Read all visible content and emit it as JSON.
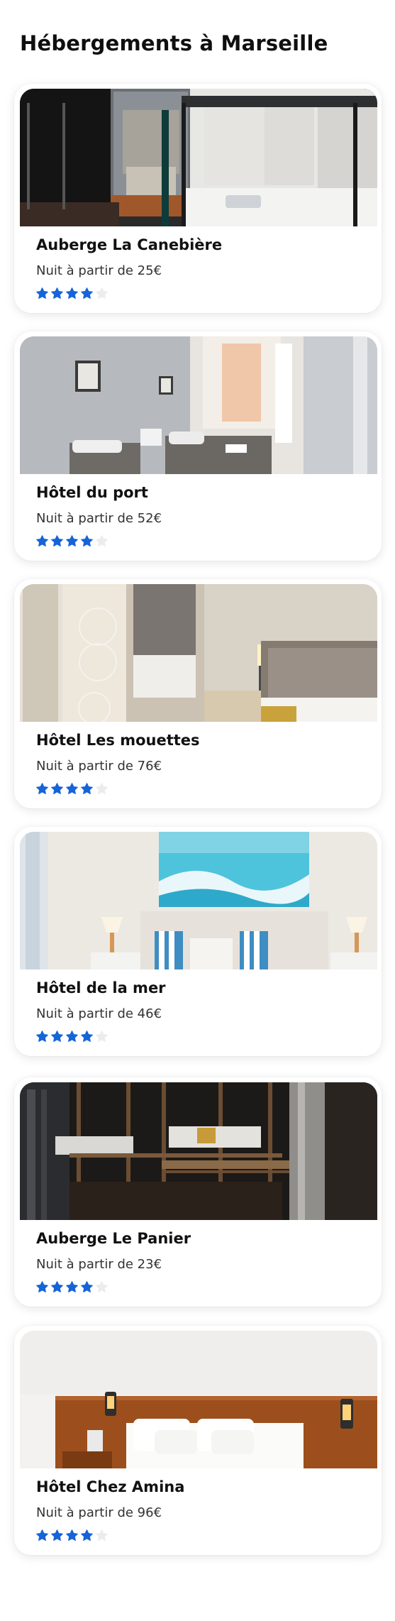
{
  "page": {
    "title": "Hébergements à Marseille"
  },
  "colors": {
    "star_filled": "#1564d8",
    "star_empty": "#ececec"
  },
  "hotels": [
    {
      "name": "Auberge La Canebière",
      "price": "Nuit à partir de 25€",
      "rating": 4,
      "max_rating": 5,
      "image_icon": "hostel-bunk-room-photo"
    },
    {
      "name": "Hôtel du port",
      "price": "Nuit à partir de 52€",
      "rating": 4,
      "max_rating": 5,
      "image_icon": "twin-bed-room-photo"
    },
    {
      "name": "Hôtel Les mouettes",
      "price": "Nuit à partir de 76€",
      "rating": 4,
      "max_rating": 5,
      "image_icon": "hotel-room-mirror-photo"
    },
    {
      "name": "Hôtel de la mer",
      "price": "Nuit à partir de 46€",
      "rating": 4,
      "max_rating": 5,
      "image_icon": "sea-painting-bedroom-photo"
    },
    {
      "name": "Auberge Le Panier",
      "price": "Nuit à partir de 23€",
      "rating": 4,
      "max_rating": 5,
      "image_icon": "wooden-bunk-beds-photo"
    },
    {
      "name": "Hôtel Chez Amina",
      "price": "Nuit à partir de 96€",
      "rating": 4,
      "max_rating": 5,
      "image_icon": "wood-headboard-bedroom-photo"
    }
  ]
}
